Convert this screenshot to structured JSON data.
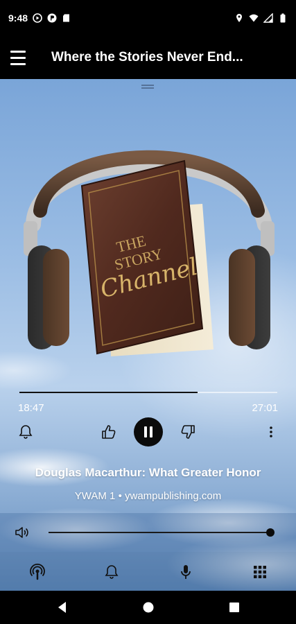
{
  "status_bar": {
    "time": "9:48",
    "left_icons": [
      "play-circle-icon",
      "p-badge-icon",
      "sd-card-icon"
    ],
    "right_icons": [
      "location-icon",
      "wifi-icon",
      "signal-icon",
      "battery-icon"
    ]
  },
  "app_bar": {
    "title": "Where the Stories Never End..."
  },
  "cover": {
    "book_title_line1": "THE",
    "book_title_line2": "STORY",
    "book_title_line3": "Channel"
  },
  "player": {
    "elapsed": "18:47",
    "total": "27:01",
    "progress": 0.69,
    "track_title": "Douglas Macarthur: What Greater Honor",
    "track_subtitle": "YWAM 1 • ywampublishing.com",
    "volume": 1.0
  },
  "colors": {
    "accent": "#0b0b0b",
    "sky_top": "#7aa5d8",
    "bar_bg": "#000000"
  }
}
